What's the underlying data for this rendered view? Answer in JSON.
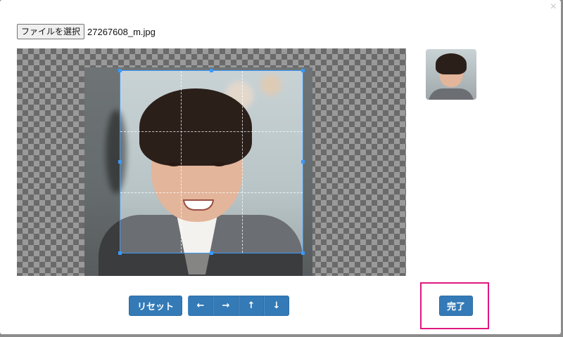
{
  "dialog": {
    "close_glyph": "×"
  },
  "file_input": {
    "button_label": "ファイルを選択",
    "file_name": "27267608_m.jpg"
  },
  "controls": {
    "reset_label": "リセット",
    "arrows": [
      "←",
      "→",
      "↑",
      "↓"
    ],
    "done_label": "完了"
  },
  "colors": {
    "primary": "#337ab7",
    "crop_border": "#3b99fc",
    "highlight": "#e0177e"
  }
}
